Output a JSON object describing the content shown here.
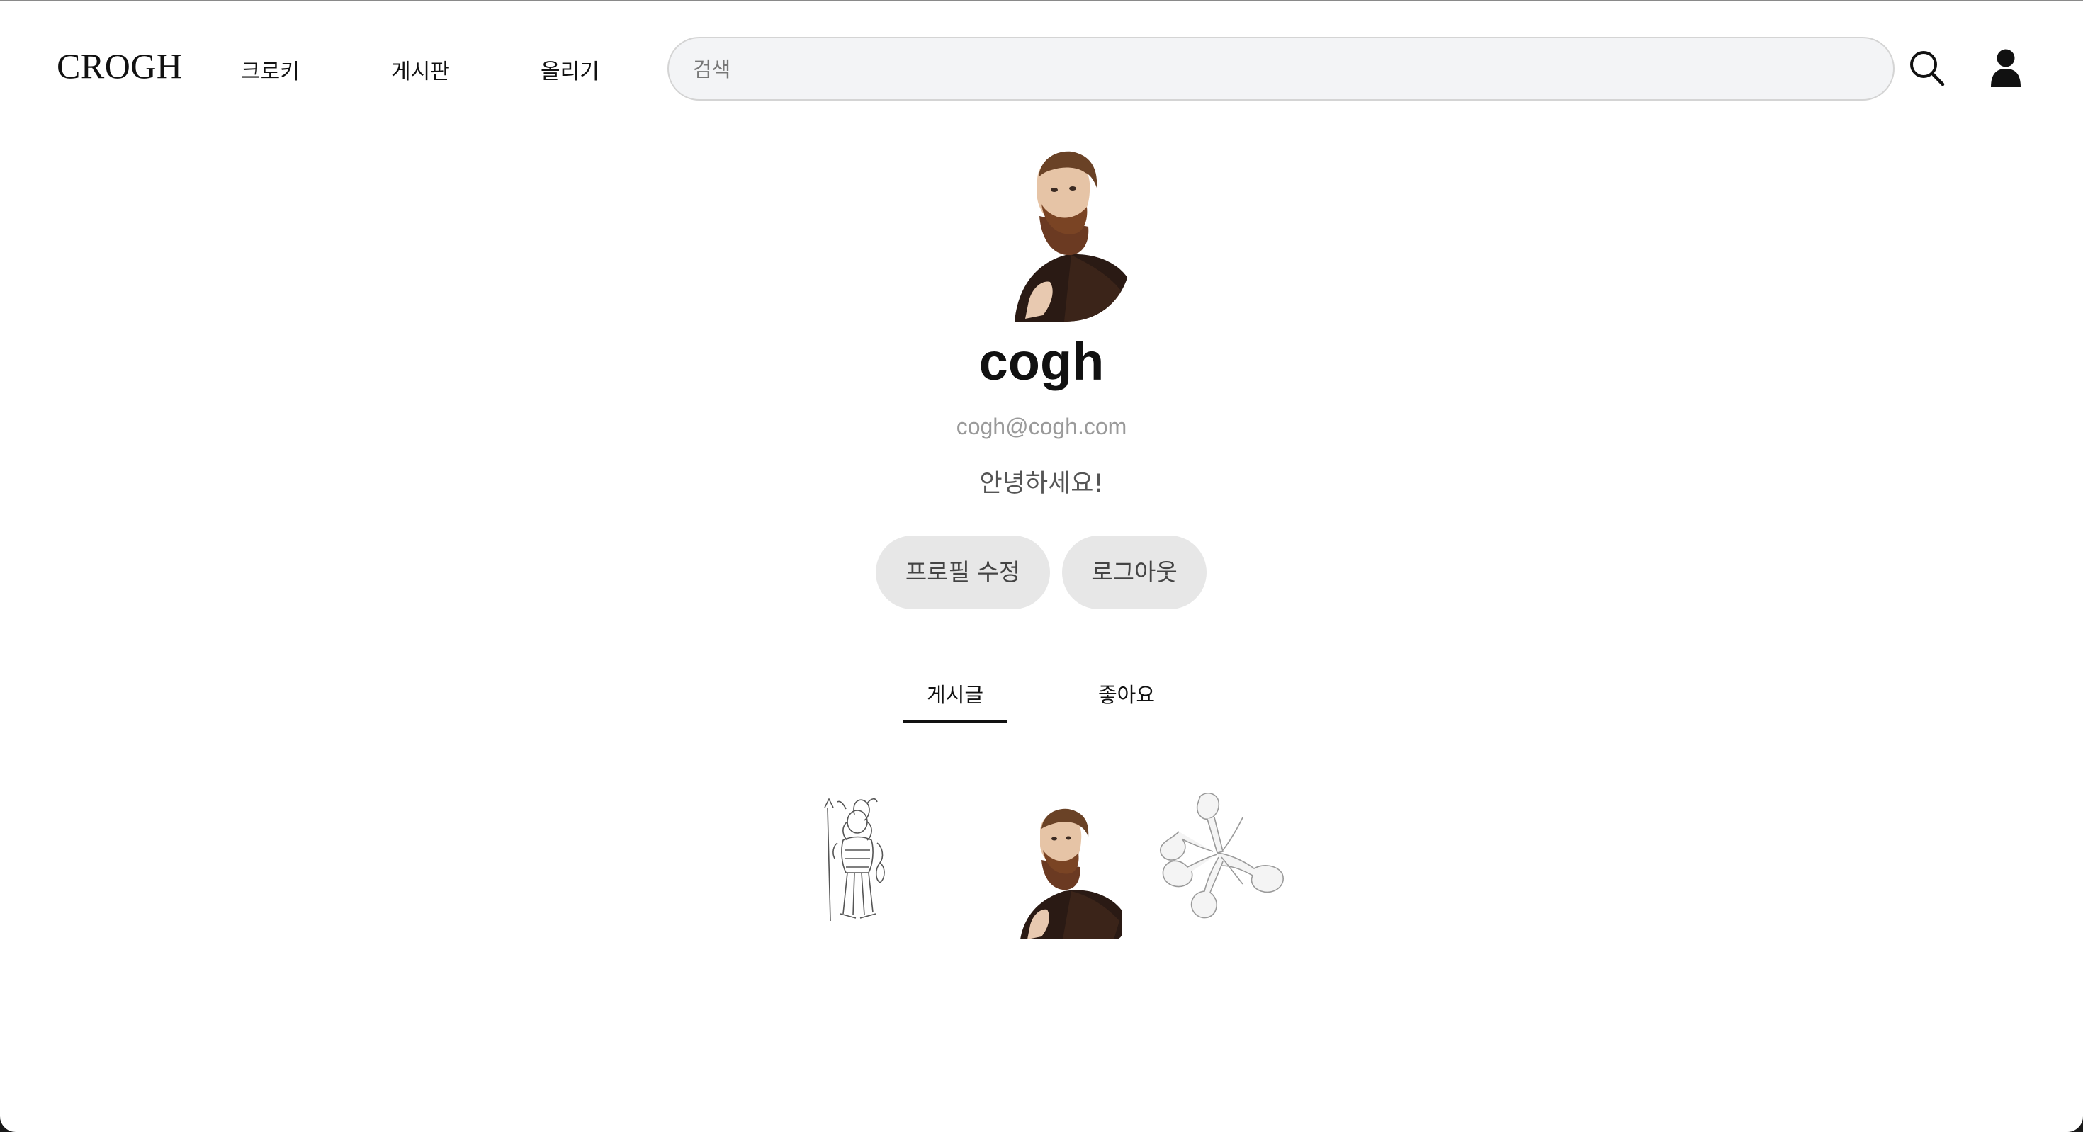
{
  "header": {
    "logo": "CROGH",
    "nav": [
      {
        "label": "크로키"
      },
      {
        "label": "게시판"
      },
      {
        "label": "올리기"
      }
    ],
    "search": {
      "placeholder": "검색",
      "value": ""
    },
    "icons": {
      "search": "search-icon",
      "profile": "user-icon"
    }
  },
  "profile": {
    "avatar": "van-gogh-portrait-image",
    "username": "cogh",
    "email": "cogh@cogh.com",
    "bio": "안녕하세요!",
    "buttons": {
      "edit": "프로필 수정",
      "logout": "로그아웃"
    }
  },
  "tabs": [
    {
      "label": "게시글",
      "active": true
    },
    {
      "label": "좋아요",
      "active": false
    }
  ],
  "posts": [
    {
      "image": "warrior-sketch-image"
    },
    {
      "image": "van-gogh-portrait-image"
    },
    {
      "image": "glass-sculpture-sketch-image"
    }
  ],
  "colors": {
    "background": "#ffffff",
    "search_bg": "#f3f4f6",
    "button_bg": "#e7e7e7",
    "email_text": "#9a9a9a",
    "text": "#111111"
  }
}
